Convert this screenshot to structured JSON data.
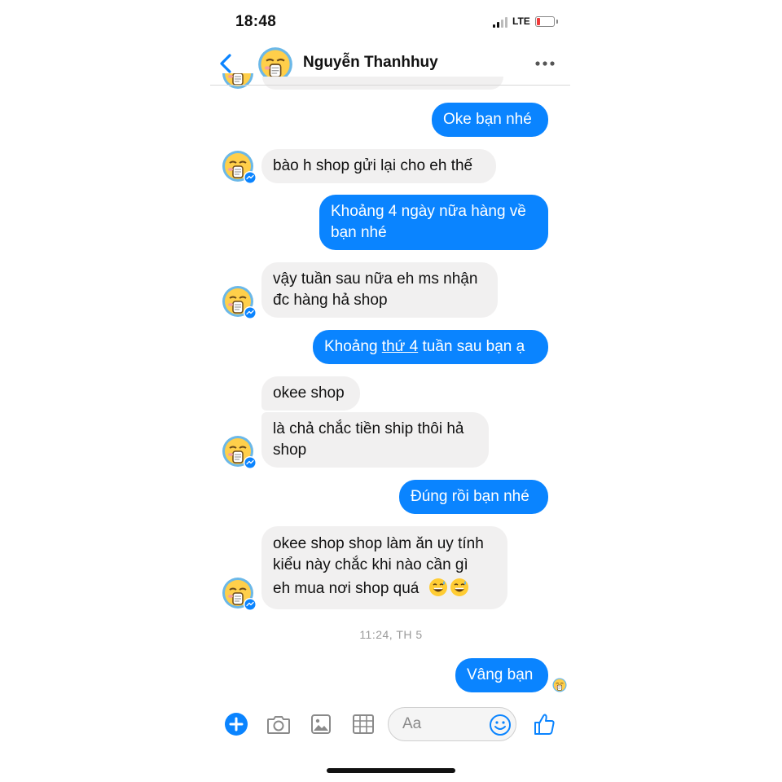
{
  "status_bar": {
    "time": "18:48",
    "network": "LTE"
  },
  "header": {
    "contact_name": "Nguyễn Thanhhuy"
  },
  "messages": [
    {
      "side": "out",
      "text": "Oke bạn nhé"
    },
    {
      "side": "in",
      "text": "bào h shop gửi lại cho eh thế"
    },
    {
      "side": "out",
      "lines": [
        "Khoảng 4 ngày nữa hàng về",
        "bạn nhé"
      ]
    },
    {
      "side": "in",
      "lines": [
        "vậy tuần sau nữa eh ms nhận",
        "đc hàng hả shop"
      ]
    },
    {
      "side": "out",
      "prefix": "Khoảng ",
      "link": "thứ 4",
      "suffix": " tuần sau bạn ạ"
    },
    {
      "side": "in",
      "text": "okee shop"
    },
    {
      "side": "in",
      "lines": [
        "là chả chắc tiền ship thôi hả",
        "shop"
      ]
    },
    {
      "side": "out",
      "text": "Đúng rồi bạn nhé"
    },
    {
      "side": "in",
      "lines": [
        "okee shop shop làm ăn uy tính",
        "kiểu này chắc khi nào cần gì",
        "eh mua nơi shop quá"
      ]
    },
    {
      "side": "out",
      "text": "Vâng bạn"
    }
  ],
  "timestamp": "11:24, TH 5",
  "composer": {
    "placeholder": "Aa"
  },
  "colors": {
    "accent": "#0a84ff",
    "incoming_bubble": "#f1f0f0"
  },
  "icons": [
    "back-chevron-icon",
    "more-dots-icon",
    "plus-icon",
    "camera-icon",
    "photo-icon",
    "sticker-grid-icon",
    "emoji-icon",
    "like-thumb-icon",
    "messenger-badge-icon"
  ]
}
